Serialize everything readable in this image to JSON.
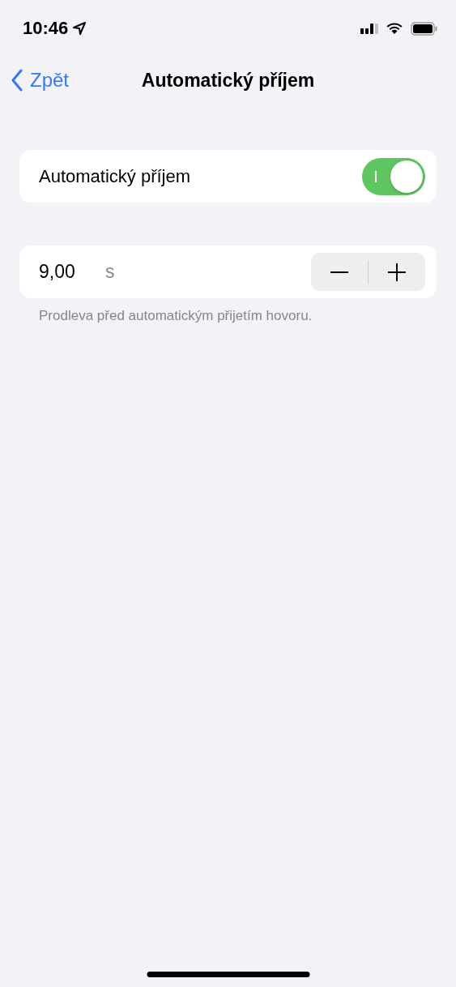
{
  "status_bar": {
    "time": "10:46"
  },
  "nav": {
    "back": "Zpět",
    "title": "Automatický příjem"
  },
  "toggle_row": {
    "label": "Automatický příjem",
    "on": true
  },
  "delay_row": {
    "value": "9,00",
    "unit": "s"
  },
  "footer": "Prodleva před automatickým přijetím hovoru."
}
